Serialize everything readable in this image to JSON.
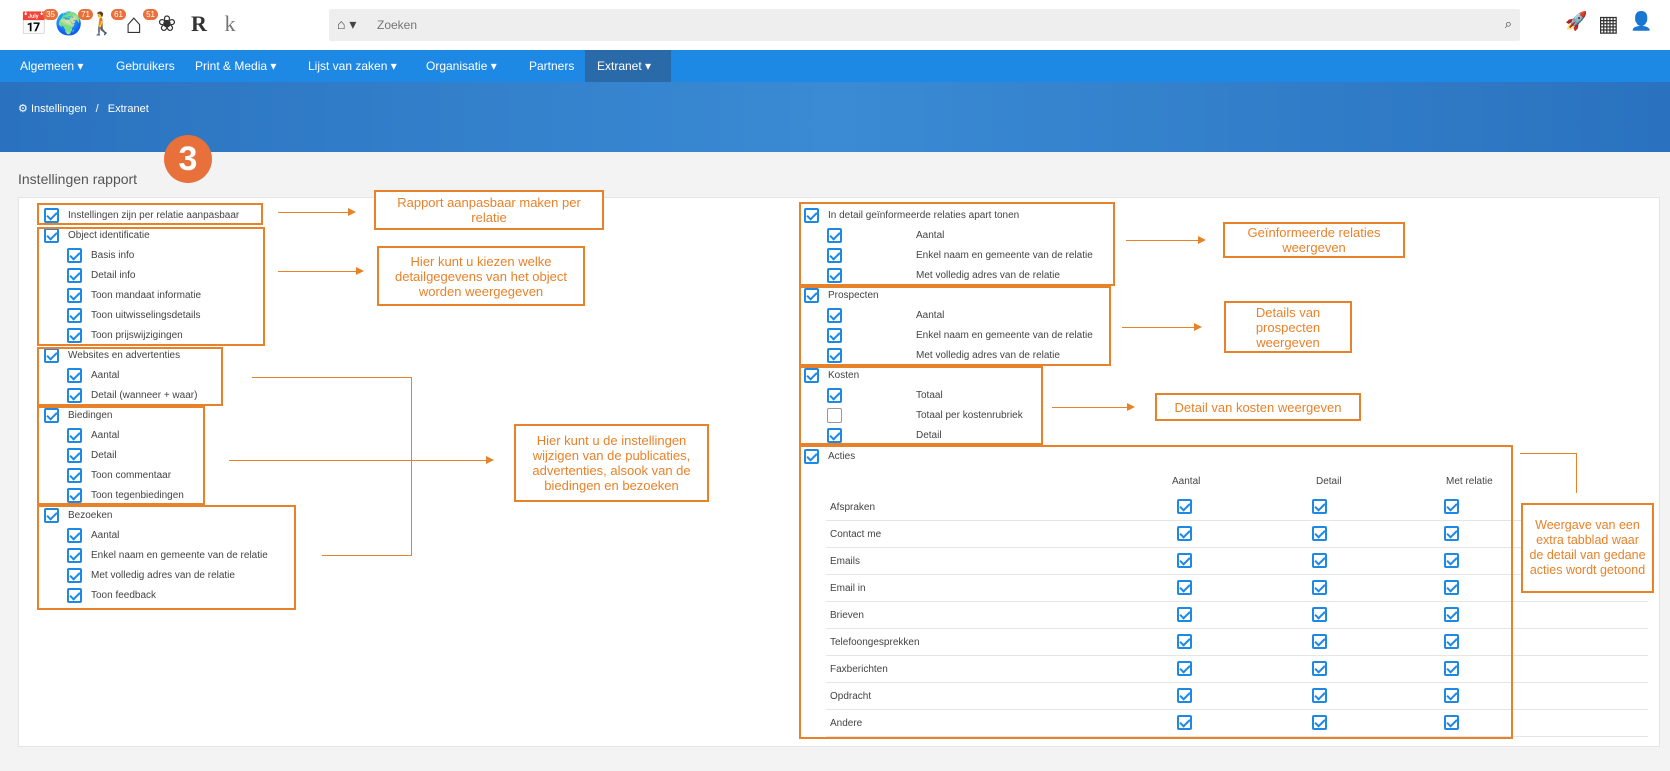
{
  "topbar": {
    "icons": [
      {
        "name": "calendar-icon",
        "glyph": "📅",
        "badge": "35"
      },
      {
        "name": "globe-icon",
        "glyph": "🌍",
        "badge": "71"
      },
      {
        "name": "person-icon",
        "glyph": "🚶",
        "badge": "61"
      },
      {
        "name": "house-icon",
        "glyph": "⌂",
        "badge": "51"
      },
      {
        "name": "flower-icon",
        "glyph": "❀",
        "badge": ""
      },
      {
        "name": "r-logo-icon",
        "glyph": "R",
        "badge": ""
      },
      {
        "name": "k-logo-icon",
        "glyph": "k",
        "badge": ""
      }
    ],
    "search_placeholder": "Zoeken",
    "home_glyph": "⌂ ▾",
    "search_glyph": "⌕",
    "rocket_glyph": "🚀",
    "apps_glyph": "▦",
    "user_glyph": "👤"
  },
  "nav": {
    "items": [
      {
        "label": "Algemeen ▾"
      },
      {
        "label": "Gebruikers"
      },
      {
        "label": "Print & Media ▾"
      },
      {
        "label": "Lijst van zaken ▾"
      },
      {
        "label": "Organisatie ▾"
      },
      {
        "label": "Partners"
      },
      {
        "label": "Extranet ▾"
      }
    ]
  },
  "breadcrumb": {
    "icon": "⚙",
    "root": "Instellingen",
    "sep": "/",
    "current": "Extranet"
  },
  "step_number": "3",
  "page_title": "Instellingen rapport",
  "left": {
    "main": "Instellingen zijn per relatie aanpasbaar",
    "object": {
      "title": "Object identificatie",
      "items": [
        "Basis info",
        "Detail info",
        "Toon mandaat informatie",
        "Toon uitwisselingsdetails",
        "Toon prijswijzigingen"
      ]
    },
    "websites": {
      "title": "Websites en advertenties",
      "items": [
        "Aantal",
        "Detail (wanneer + waar)"
      ]
    },
    "biedingen": {
      "title": "Biedingen",
      "items": [
        "Aantal",
        "Detail",
        "Toon commentaar",
        "Toon tegenbiedingen"
      ]
    },
    "bezoeken": {
      "title": "Bezoeken",
      "items": [
        "Aantal",
        "Enkel naam en gemeente van de relatie",
        "Met volledig adres van de relatie",
        "Toon feedback"
      ]
    }
  },
  "right": {
    "informeerde": {
      "title": "In detail geïnformeerde relaties apart tonen",
      "items": [
        "Aantal",
        "Enkel naam en gemeente van de relatie",
        "Met volledig adres van de relatie"
      ]
    },
    "prospecten": {
      "title": "Prospecten",
      "items": [
        "Aantal",
        "Enkel naam en gemeente van de relatie",
        "Met volledig adres van de relatie"
      ]
    },
    "kosten": {
      "title": "Kosten",
      "items": [
        "Totaal",
        "Totaal per kostenrubriek",
        "Detail"
      ],
      "checked": [
        true,
        false,
        true
      ]
    },
    "acties": {
      "title": "Acties",
      "columns": [
        "Aantal",
        "Detail",
        "Met relatie"
      ],
      "rows": [
        "Afspraken",
        "Contact me",
        "Emails",
        "Email in",
        "Brieven",
        "Telefoongesprekken",
        "Faxberichten",
        "Opdracht",
        "Andere"
      ]
    }
  },
  "notes": {
    "n1": "Rapport aanpasbaar maken per relatie",
    "n2": "Hier kunt u kiezen welke detailgegevens van het object worden weergegeven",
    "n3": "Hier kunt u de instellingen wijzigen van de publicaties, advertenties, alsook van de biedingen en bezoeken",
    "n4": "Geïnformeerde relaties weergeven",
    "n5": "Details van prospecten weergeven",
    "n6": "Detail van kosten weergeven",
    "n7": "Weergave van een extra tabblad waar de detail van gedane acties wordt getoond"
  }
}
